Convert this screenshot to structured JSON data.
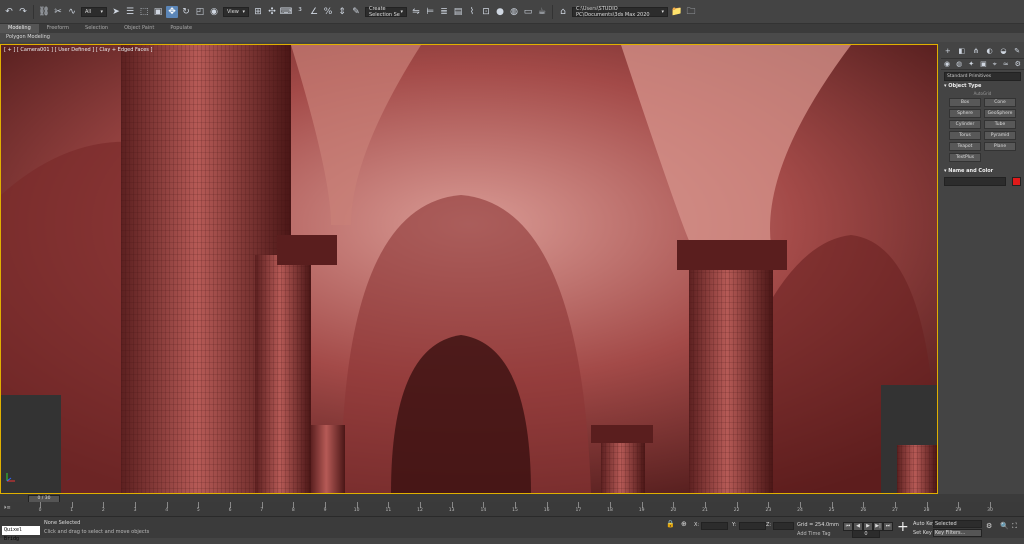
{
  "toolbar": {
    "all_filter": "All",
    "view_dropdown": "View",
    "selection_set": "Create Selection Se",
    "path": "C:\\Users\\STUDIO PC\\Documents\\3ds Max 2020"
  },
  "ribbon": {
    "tabs": [
      "Modeling",
      "Freeform",
      "Selection",
      "Object Paint",
      "Populate"
    ],
    "sub_label": "Polygon Modeling"
  },
  "viewport": {
    "label": "[ + ] [ Camera001 ] [ User Defined ] [ Clay + Edged Faces ]"
  },
  "command_panel": {
    "category": "Standard Primitives",
    "object_type_title": "Object Type",
    "autogrid": "AutoGrid",
    "buttons": [
      "Box",
      "Cone",
      "Sphere",
      "GeoSphere",
      "Cylinder",
      "Tube",
      "Torus",
      "Pyramid",
      "Teapot",
      "Plane",
      "TextPlus"
    ],
    "name_color_title": "Name and Color",
    "color": "#e01a1a"
  },
  "timeline": {
    "slider": "0 / 30",
    "ticks": [
      "0",
      "1",
      "2",
      "3",
      "4",
      "5",
      "6",
      "7",
      "8",
      "9",
      "10",
      "11",
      "12",
      "13",
      "14",
      "15",
      "16",
      "17",
      "18",
      "19",
      "20",
      "21",
      "22",
      "23",
      "24",
      "25",
      "26",
      "27",
      "28",
      "29",
      "30"
    ]
  },
  "status": {
    "script_listener": "Quixel Bridg",
    "selection": "None Selected",
    "prompt": "Click and drag to select and move objects",
    "x_label": "X:",
    "y_label": "Y:",
    "z_label": "Z:",
    "grid": "Grid = 254.0mm",
    "add_time_tag": "Add Time Tag",
    "auto_key": "Auto Key",
    "set_key": "Set Key",
    "key_mode": "Selected",
    "key_filters": "Key Filters...",
    "frame": "0"
  }
}
